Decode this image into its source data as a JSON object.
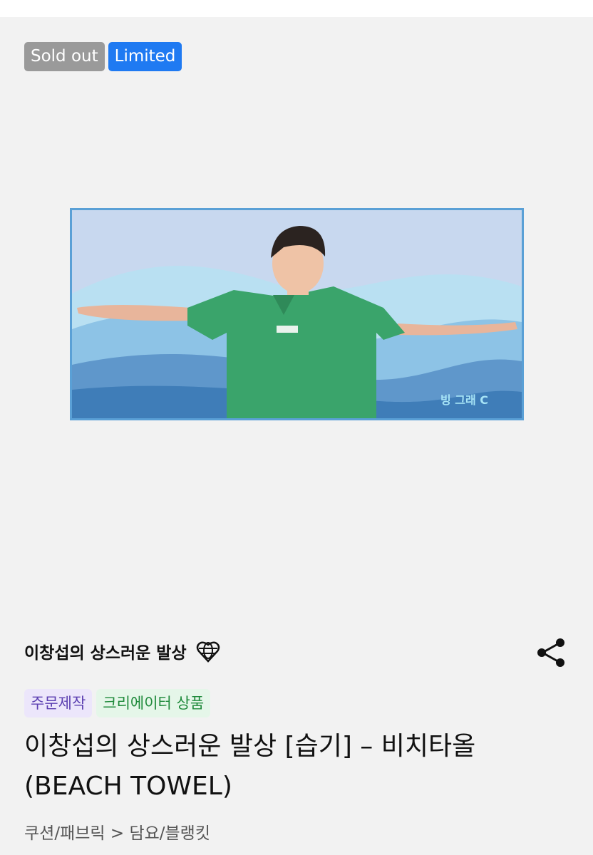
{
  "badges": {
    "sold_out": "Sold out",
    "limited": "Limited"
  },
  "product": {
    "image_caption": "빙 그래 C",
    "shop_name": "이창섭의 상스러운 발상",
    "tags": [
      "주문제작",
      "크리에이터 상품"
    ],
    "title": "이창섭의 상스러운 발상 [습기] – 비치타올 (BEACH TOWEL)",
    "breadcrumb": "쿠션/패브릭 > 담요/블랭킷"
  },
  "colors": {
    "badge_gray": "#9a9a9a",
    "badge_blue": "#1f7af2",
    "tag_purple_bg": "#ece6fb",
    "tag_purple_text": "#5b3fb1",
    "tag_green_bg": "#e5f6e9",
    "tag_green_text": "#1f8a3b"
  },
  "icons": {
    "shop": "heart-globe-icon",
    "share": "share-icon"
  }
}
